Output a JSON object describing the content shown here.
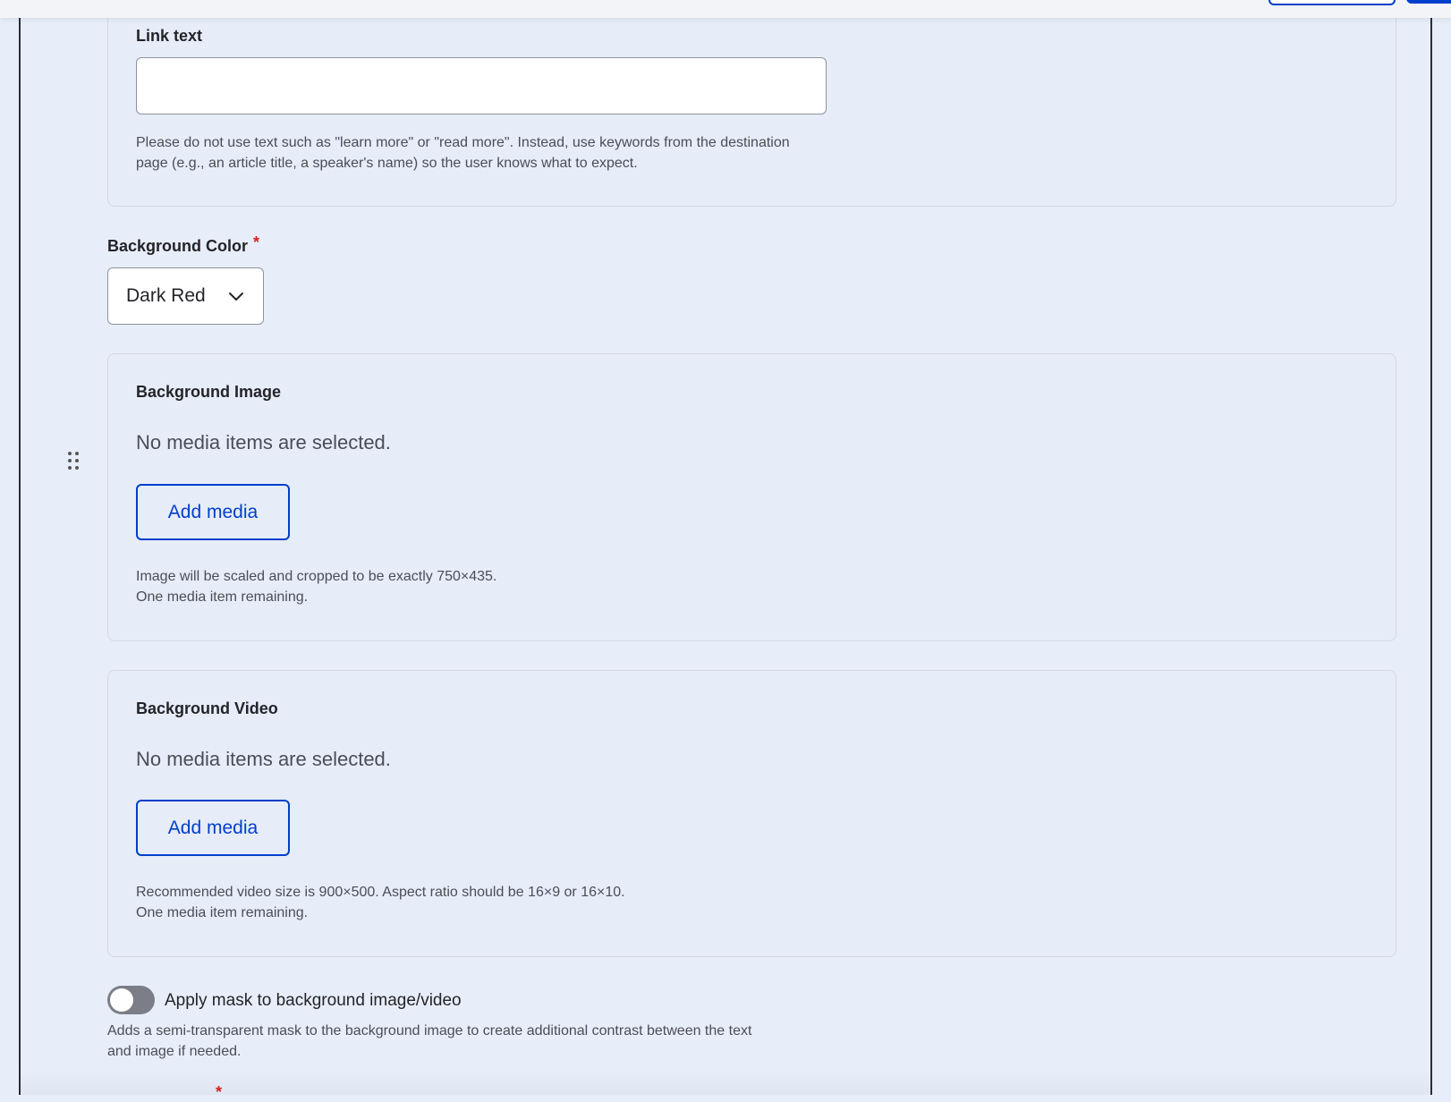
{
  "link_text": {
    "label": "Link text",
    "value": "",
    "placeholder": "",
    "description_line1": "Please do not use text such as \"learn more\" or \"read more\". Instead, use keywords from the destination",
    "description_line2": "page (e.g., an article title, a speaker's name) so the user knows what to expect."
  },
  "background_color": {
    "label": "Background Color",
    "required_mark": "*",
    "selected": "Dark Red"
  },
  "background_image": {
    "label": "Background Image",
    "empty_text": "No media items are selected.",
    "button_label": "Add media",
    "help_line1": "Image will be scaled and cropped to be exactly 750×435.",
    "help_line2": "One media item remaining."
  },
  "background_video": {
    "label": "Background Video",
    "empty_text": "No media items are selected.",
    "button_label": "Add media",
    "help_line1": "Recommended video size is 900×500. Aspect ratio should be 16×9 or 16×10.",
    "help_line2": "One media item remaining."
  },
  "mask_toggle": {
    "label": "Apply mask to background image/video",
    "checked": false,
    "description_line1": "Adds a semi-transparent mask to the background image to create additional contrast between the text",
    "description_line2": "and image if needed."
  },
  "next_field": {
    "required_mark": "*"
  },
  "colors": {
    "accent": "#003ecc",
    "required": "#d72222",
    "page_background": "#e8eef9"
  },
  "icons": {
    "drag": "drag-handle-icon",
    "select": "chevron-down-icon"
  }
}
